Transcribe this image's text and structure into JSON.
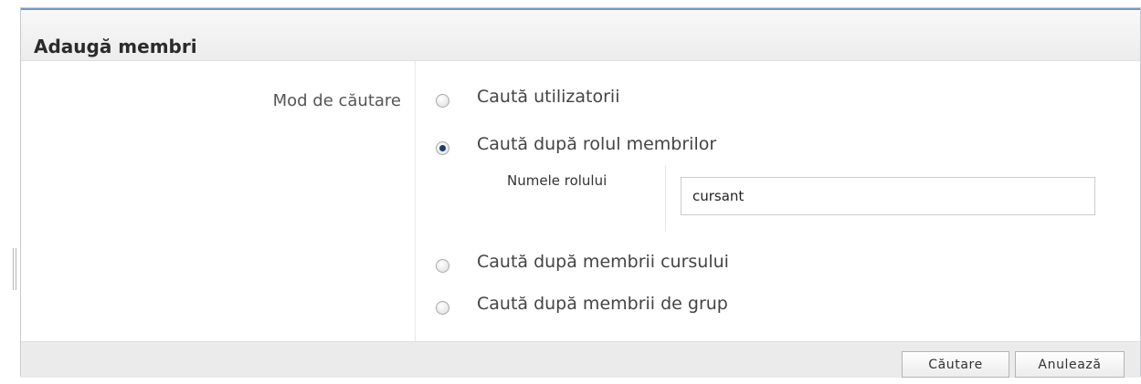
{
  "dialog": {
    "title": "Adaugă membri",
    "mode_label": "Mod de căutare",
    "options": [
      {
        "label": "Caută utilizatorii",
        "checked": false
      },
      {
        "label": "Caută după rolul membrilor",
        "checked": true
      },
      {
        "label": "Caută după membrii cursului",
        "checked": false
      },
      {
        "label": "Caută după membrii de grup",
        "checked": false
      }
    ],
    "role": {
      "label": "Numele rolului",
      "value": "cursant"
    },
    "buttons": {
      "search": "Căutare",
      "cancel": "Anulează"
    }
  },
  "colors": {
    "header_accent": "#6f9ad0",
    "radio_dot": "#1d3c67"
  }
}
